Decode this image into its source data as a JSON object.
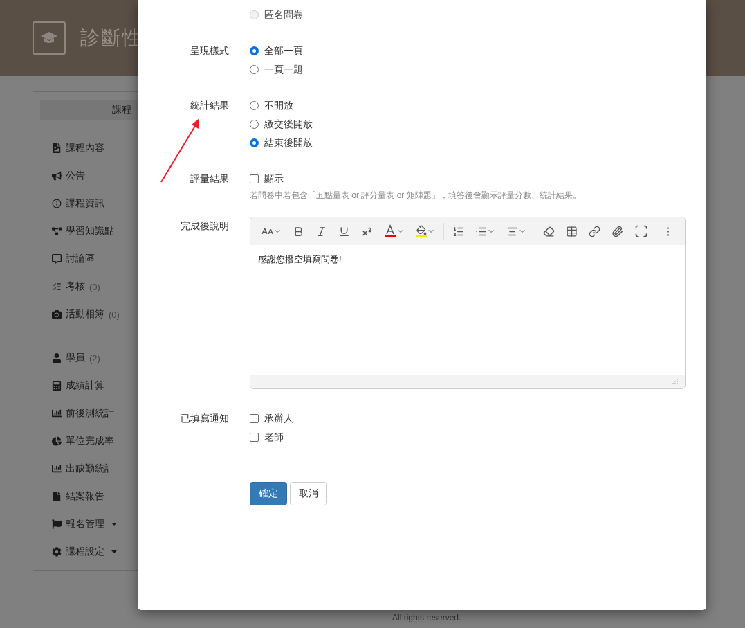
{
  "header": {
    "title": "診斷性"
  },
  "sidebar": {
    "title": "課程",
    "items": [
      {
        "kind": "link",
        "label": "課程內容"
      },
      {
        "kind": "link",
        "label": "公告"
      },
      {
        "kind": "link",
        "label": "課程資訊"
      },
      {
        "kind": "link",
        "label": "學習知識點"
      },
      {
        "kind": "link",
        "label": "討論區"
      },
      {
        "kind": "link",
        "label": "考核",
        "count": "(0)"
      },
      {
        "kind": "link",
        "label": "活動相簿",
        "count": "(0)"
      },
      {
        "kind": "divider"
      },
      {
        "kind": "link",
        "label": "學員",
        "count": "(2)"
      },
      {
        "kind": "link",
        "label": "成績計算"
      },
      {
        "kind": "link",
        "label": "前後測統計"
      },
      {
        "kind": "link",
        "label": "單位完成率"
      },
      {
        "kind": "link",
        "label": "出缺勤統計"
      },
      {
        "kind": "link",
        "label": "結案報告"
      },
      {
        "kind": "menu",
        "label": "報名管理"
      },
      {
        "kind": "menu",
        "label": "課程設定"
      }
    ]
  },
  "modal": {
    "sections": [
      {
        "kind": "radio",
        "options": [
          {
            "label": "匿名問卷",
            "selected": false,
            "disabled": true
          }
        ]
      },
      {
        "kind": "radio",
        "label": "呈現樣式",
        "options": [
          {
            "label": "全部一頁",
            "selected": true,
            "disabled": false
          },
          {
            "label": "一頁一題",
            "selected": false,
            "disabled": false
          }
        ]
      },
      {
        "kind": "radio",
        "label": "統計結果",
        "options": [
          {
            "label": "不開放",
            "selected": false,
            "disabled": false
          },
          {
            "label": "繳交後開放",
            "selected": false,
            "disabled": false
          },
          {
            "label": "結束後開放",
            "selected": true,
            "disabled": false
          }
        ]
      },
      {
        "kind": "checkbox",
        "label": "評量結果",
        "options": [
          {
            "label": "顯示",
            "checked": false
          }
        ],
        "help": "若問卷中若包含「五點量表 or 評分量表 or 矩陣題」，填答後會顯示評量分數、統計結果。"
      },
      {
        "kind": "editor",
        "label": "完成後說明",
        "content": "感謝您撥空填寫問卷!"
      },
      {
        "kind": "checkbox",
        "label": "已填寫通知",
        "options": [
          {
            "label": "承辦人",
            "checked": false
          },
          {
            "label": "老師",
            "checked": false
          }
        ]
      }
    ],
    "buttons": [
      {
        "label": "確定",
        "primary": true
      },
      {
        "label": "取消",
        "primary": false
      }
    ]
  },
  "footer": {
    "text": "All rights reserved."
  }
}
